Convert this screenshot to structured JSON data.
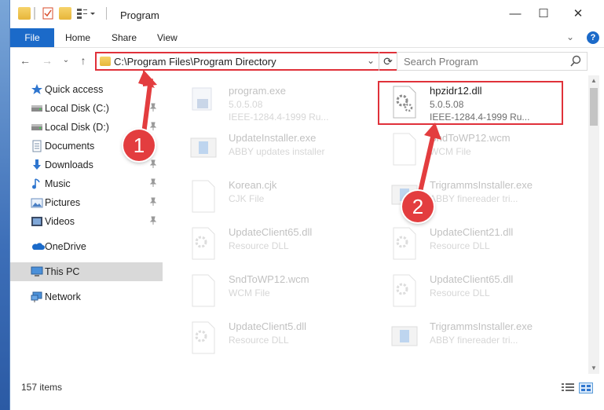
{
  "window": {
    "title": "Program"
  },
  "ribbon": {
    "tabs": [
      "File",
      "Home",
      "Share",
      "View"
    ]
  },
  "address": {
    "path": "C:\\Program Files\\Program Directory"
  },
  "search": {
    "placeholder": "Search Program"
  },
  "nav": {
    "items": [
      {
        "label": "Quick access",
        "icon": "star-icon",
        "pinned": false
      },
      {
        "label": "Local Disk (C:)",
        "icon": "drive-icon",
        "pinned": true
      },
      {
        "label": "Local Disk (D:)",
        "icon": "drive-icon",
        "pinned": true
      },
      {
        "label": "Documents",
        "icon": "documents-icon",
        "pinned": true
      },
      {
        "label": "Downloads",
        "icon": "download-icon",
        "pinned": true
      },
      {
        "label": "Music",
        "icon": "music-icon",
        "pinned": true
      },
      {
        "label": "Pictures",
        "icon": "pictures-icon",
        "pinned": true
      },
      {
        "label": "Videos",
        "icon": "videos-icon",
        "pinned": true
      },
      {
        "label": "OneDrive",
        "icon": "cloud-icon",
        "pinned": false
      },
      {
        "label": "This PC",
        "icon": "pc-icon",
        "pinned": false,
        "selected": true
      },
      {
        "label": "Network",
        "icon": "network-icon",
        "pinned": false
      }
    ]
  },
  "files": [
    {
      "name": "program.exe",
      "line1": "5.0.5.08",
      "line2": "IEEE-1284.4-1999 Ru...",
      "icon": "exe-icon",
      "highlighted": false
    },
    {
      "name": "hpzidr12.dll",
      "line1": "5.0.5.08",
      "line2": "IEEE-1284.4-1999 Ru...",
      "icon": "dll-icon",
      "highlighted": true
    },
    {
      "name": "UpdateInstaller.exe",
      "line1": "ABBY updates installer",
      "icon": "installer-icon"
    },
    {
      "name": "SndToWP12.wcm",
      "line1": "WCM File",
      "icon": "file-icon"
    },
    {
      "name": "Korean.cjk",
      "line1": "CJK File",
      "icon": "file-icon"
    },
    {
      "name": "TrigrammsInstaller.exe",
      "line1": "ABBY finereader tri...",
      "icon": "installer-icon"
    },
    {
      "name": "UpdateClient65.dll",
      "line1": "Resource DLL",
      "icon": "dll-icon"
    },
    {
      "name": "UpdateClient21.dll",
      "line1": "Resource DLL",
      "icon": "dll-icon"
    },
    {
      "name": "SndToWP12.wcm",
      "line1": "WCM File",
      "icon": "file-icon"
    },
    {
      "name": "UpdateClient65.dll",
      "line1": "Resource DLL",
      "icon": "dll-icon"
    },
    {
      "name": "UpdateClient5.dll",
      "line1": "Resource DLL",
      "icon": "dll-icon"
    },
    {
      "name": "TrigrammsInstaller.exe",
      "line1": "ABBY finereader tri...",
      "icon": "installer-icon"
    }
  ],
  "status": {
    "items": "157 items"
  },
  "callouts": [
    "1",
    "2"
  ],
  "colors": {
    "accent": "#1b6ac9",
    "highlight": "#e0313a"
  }
}
